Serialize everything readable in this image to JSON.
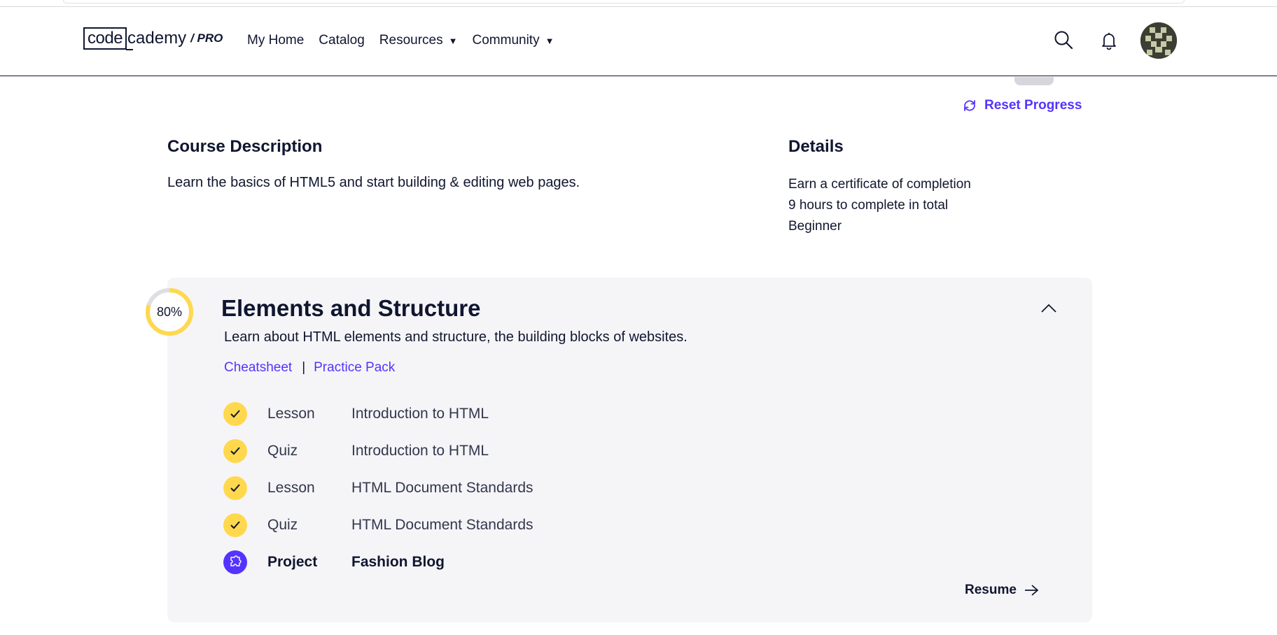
{
  "brand": {
    "code": "code",
    "cademy": "cademy",
    "pro": "/ PRO"
  },
  "nav": [
    {
      "label": "My Home",
      "dropdown": false
    },
    {
      "label": "Catalog",
      "dropdown": false
    },
    {
      "label": "Resources",
      "dropdown": true
    },
    {
      "label": "Community",
      "dropdown": true
    }
  ],
  "header_icons": [
    "search-icon",
    "bell-icon",
    "avatar"
  ],
  "reset_progress": "Reset Progress",
  "course": {
    "description_title": "Course Description",
    "description": "Learn the basics of HTML5 and start building & editing web pages.",
    "details_title": "Details",
    "details": [
      "Earn a certificate of completion",
      "9 hours to complete in total",
      "Beginner"
    ]
  },
  "module": {
    "progress_label": "80%",
    "progress": 0.8,
    "title": "Elements and Structure",
    "description": "Learn about HTML elements and structure, the building blocks of websites.",
    "links": [
      "Cheatsheet",
      "Practice Pack"
    ],
    "link_separator": "|",
    "items": [
      {
        "type": "Lesson",
        "title": "Introduction to HTML",
        "status": "complete"
      },
      {
        "type": "Quiz",
        "title": "Introduction to HTML",
        "status": "complete"
      },
      {
        "type": "Lesson",
        "title": "HTML Document Standards",
        "status": "complete"
      },
      {
        "type": "Quiz",
        "title": "HTML Document Standards",
        "status": "complete"
      },
      {
        "type": "Project",
        "title": "Fashion Blog",
        "status": "current"
      }
    ],
    "resume_label": "Resume"
  },
  "colors": {
    "accent": "#5533ff",
    "complete": "#ffd84d",
    "navy": "#10162f",
    "module_bg": "#f5f5f8"
  }
}
